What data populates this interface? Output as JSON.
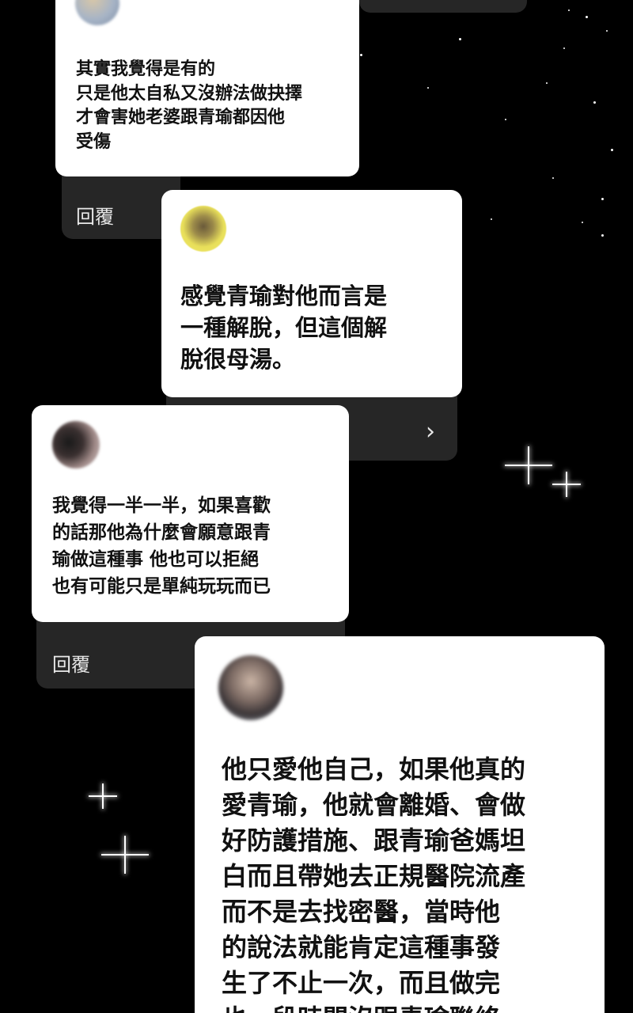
{
  "comments": [
    {
      "text": "其實我覺得是有的\n只是他太自私又沒辦法做抉擇\n才會害她老婆跟青瑜都因他\n受傷",
      "reply_label": "回覆"
    },
    {
      "text": "感覺青瑜對他而言是\n一種解脫，但這個解\n脫很母湯。",
      "action_icon": "chevron-right-icon"
    },
    {
      "text": "我覺得一半一半，如果喜歡\n的話那他為什麼會願意跟青\n瑜做這種事 他也可以拒絕\n也有可能只是單純玩玩而已",
      "reply_label": "回覆"
    },
    {
      "text": "他只愛他自己，如果他真的\n愛青瑜，他就會離婚、會做\n好防護措施、跟青瑜爸媽坦\n白而且帶她去正規醫院流產\n而不是去找密醫，當時他\n的說法就能肯定這種事發\n生了不止一次，而且做完\n也一段時間沒跟青瑜聯絡"
    }
  ],
  "icons": {
    "chevron": "›"
  },
  "colors": {
    "background": "#000000",
    "card": "#ffffff",
    "reply_bar": "#262626",
    "text": "#111111"
  }
}
